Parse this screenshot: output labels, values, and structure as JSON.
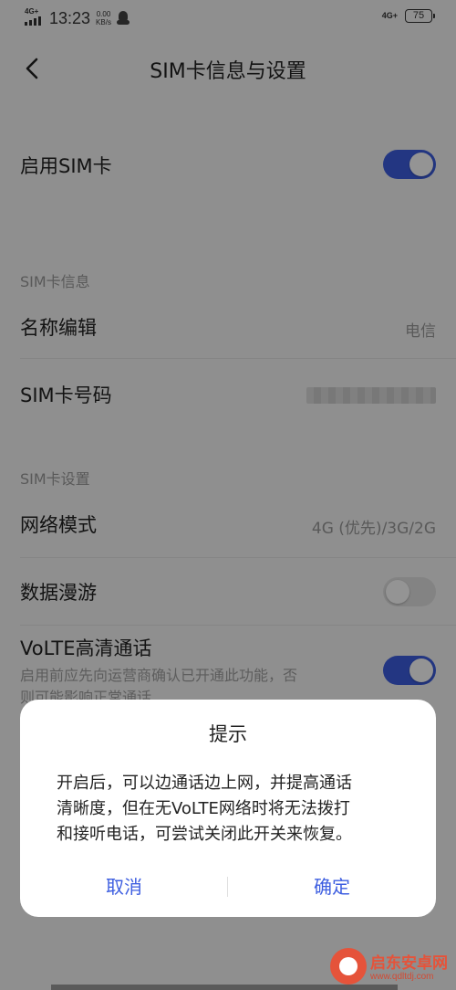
{
  "status_bar": {
    "network_left": "4G+",
    "time": "13:23",
    "speed_value": "0.00",
    "speed_unit": "KB/s",
    "network_right": "4G+",
    "battery": "75"
  },
  "header": {
    "title": "SIM卡信息与设置"
  },
  "settings": {
    "enable_sim": {
      "label": "启用SIM卡",
      "on": true
    },
    "section_info": "SIM卡信息",
    "name_edit": {
      "label": "名称编辑",
      "value": "电信"
    },
    "sim_number": {
      "label": "SIM卡号码"
    },
    "section_settings": "SIM卡设置",
    "network_mode": {
      "label": "网络模式",
      "value": "4G (优先)/3G/2G"
    },
    "data_roaming": {
      "label": "数据漫游",
      "on": false
    },
    "volte": {
      "label": "VoLTE高清通话",
      "subtext_line1": "启用前应先向运营商确认已开通此功能，否",
      "subtext_line2": "则可能影响正常通话",
      "on": true
    }
  },
  "dialog": {
    "title": "提示",
    "message_line1": "开启后，可以边通话边上网，并提高通话",
    "message_line2": "清晰度，但在无VoLTE网络时将无法拨打",
    "message_line3": "和接听电话，可尝试关闭此开关来恢复。",
    "cancel": "取消",
    "confirm": "确定"
  },
  "watermark": {
    "name": "启东安卓网",
    "url": "www.qdltdj.com"
  },
  "colors": {
    "accent": "#3d5ee0",
    "watermark": "#e5533a"
  }
}
